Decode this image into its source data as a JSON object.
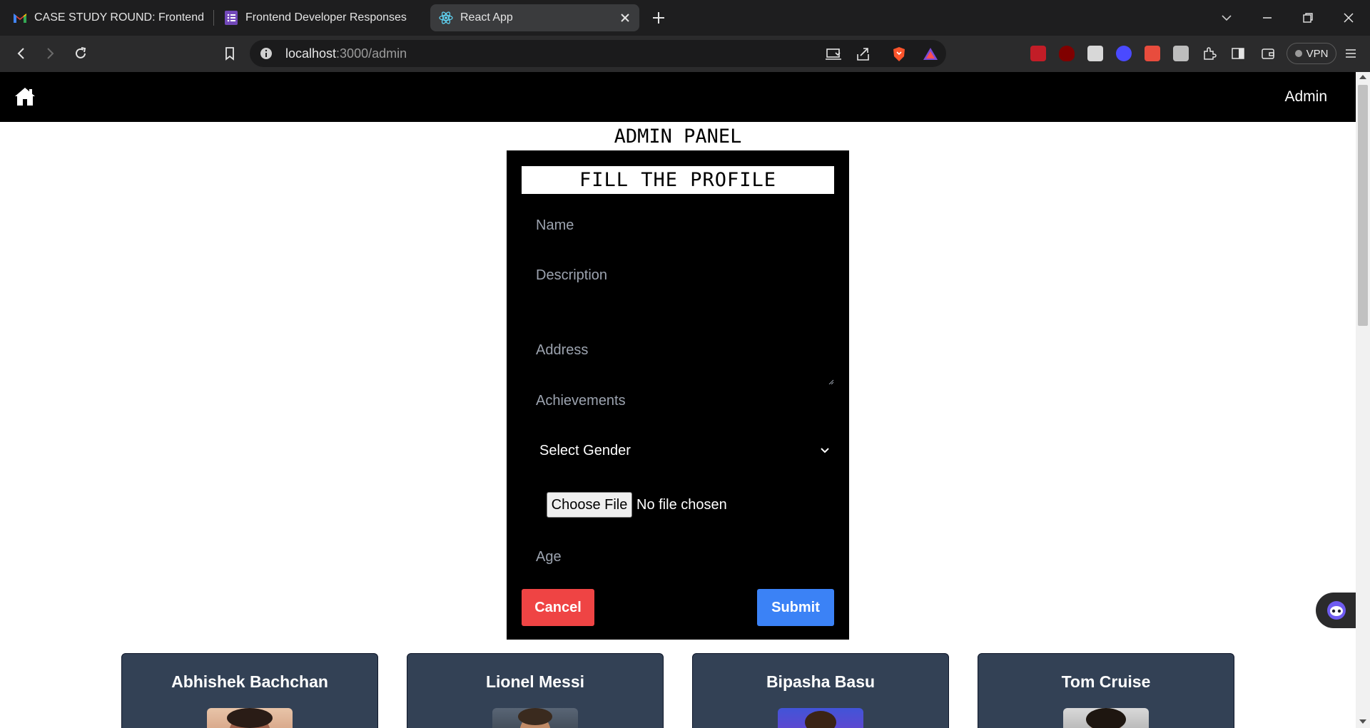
{
  "browser": {
    "tabs": [
      {
        "title": "CASE STUDY ROUND: Frontend Deve",
        "icon": "gmail-icon",
        "active": false
      },
      {
        "title": "Frontend Developer Responses",
        "icon": "forms-icon",
        "active": false
      },
      {
        "title": "React App",
        "icon": "react-icon",
        "active": true
      }
    ],
    "url_host": "localhost",
    "url_path": ":3000/admin",
    "vpn_label": "VPN"
  },
  "navbar": {
    "admin_link": "Admin"
  },
  "page": {
    "title": "ADMIN PANEL"
  },
  "form": {
    "heading": "FILL THE PROFILE",
    "name_placeholder": "Name",
    "description_placeholder": "Description",
    "address_placeholder": "Address",
    "achievements_placeholder": "Achievements",
    "gender_select": "Select Gender",
    "file_button": "Choose File",
    "file_status": "No file chosen",
    "age_placeholder": "Age",
    "cancel_label": "Cancel",
    "submit_label": "Submit"
  },
  "profiles": [
    {
      "name": "Abhishek Bachchan"
    },
    {
      "name": "Lionel Messi"
    },
    {
      "name": "Bipasha Basu"
    },
    {
      "name": "Tom Cruise"
    }
  ],
  "colors": {
    "card_bg": "#334155",
    "cancel": "#ef4444",
    "submit": "#3b82f6",
    "navbar": "#000000"
  }
}
